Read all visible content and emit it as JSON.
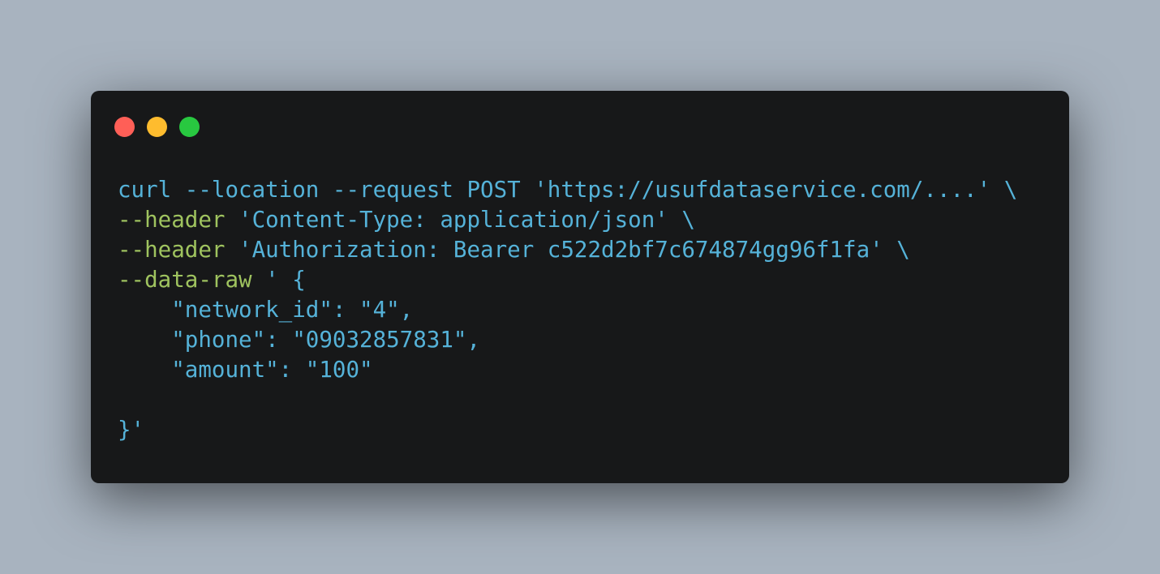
{
  "window": {
    "controls": [
      "close",
      "minimize",
      "zoom"
    ],
    "colors": {
      "background": "#a8b3bf",
      "window": "#171819",
      "close": "#ff5f57",
      "minimize": "#febc2e",
      "zoom": "#28c840",
      "text": "#55b2d8",
      "flag": "#9fc35f"
    }
  },
  "code": {
    "lines": [
      {
        "base": "curl --location --request POST ",
        "str": "'https://usufdataservice.com/....'",
        "tail": " \\"
      },
      {
        "flag": "--header",
        "str": " 'Content-Type: application/json'",
        "tail": " \\"
      },
      {
        "flag": "--header",
        "str": " 'Authorization: Bearer c522d2bf7c674874gg96f1fa'",
        "tail": " \\"
      },
      {
        "flag": "--data-raw",
        "str": " ' {"
      },
      {
        "str": "    \"network_id\": \"4\","
      },
      {
        "str": "    \"phone\": \"09032857831\","
      },
      {
        "str": "    \"amount\": \"100\""
      },
      {
        "str": ""
      },
      {
        "str": "}'"
      }
    ]
  }
}
